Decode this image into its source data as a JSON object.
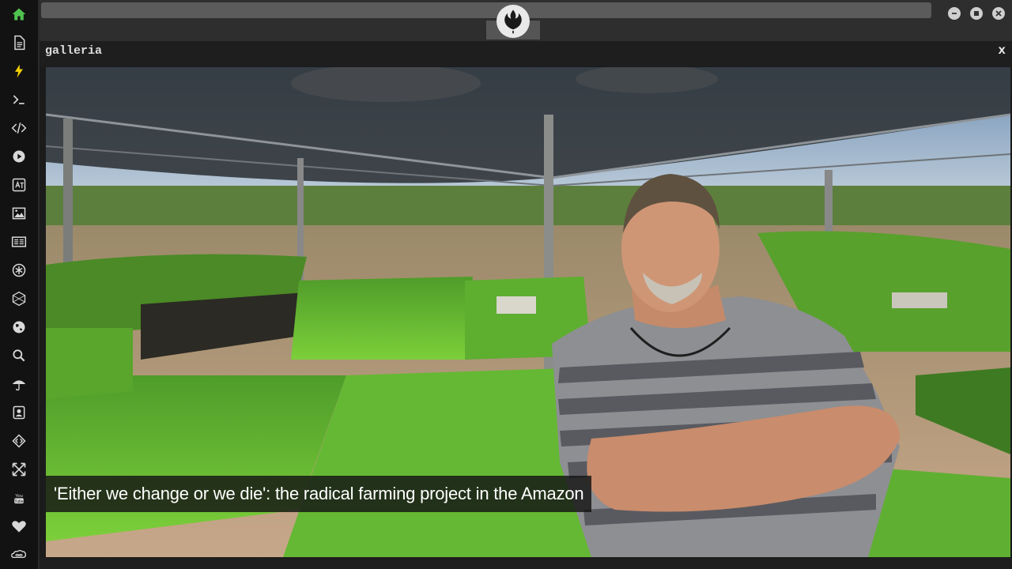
{
  "window": {
    "title": "galleria",
    "close_label": "x"
  },
  "sidebar": {
    "items": [
      {
        "icon": "home-icon",
        "active": true
      },
      {
        "icon": "document-icon"
      },
      {
        "icon": "lightning-icon"
      },
      {
        "icon": "terminal-icon"
      },
      {
        "icon": "code-icon"
      },
      {
        "icon": "play-icon"
      },
      {
        "icon": "translate-icon"
      },
      {
        "icon": "image-icon"
      },
      {
        "icon": "news-icon"
      },
      {
        "icon": "asterisk-icon"
      },
      {
        "icon": "hexagon-icon"
      },
      {
        "icon": "globe-icon"
      },
      {
        "icon": "search-icon"
      },
      {
        "icon": "umbrella-icon"
      },
      {
        "icon": "contact-card-icon"
      },
      {
        "icon": "code-tags-icon"
      },
      {
        "icon": "expand-icon"
      },
      {
        "icon": "youtube-icon"
      },
      {
        "icon": "heart-icon"
      },
      {
        "icon": "infinity-cloud-icon"
      }
    ]
  },
  "gallery": {
    "caption": "'Either we change or we die': the radical farming project in the Amazon"
  },
  "colors": {
    "accent": "#4fc24f",
    "icon": "#d8d8d8"
  }
}
